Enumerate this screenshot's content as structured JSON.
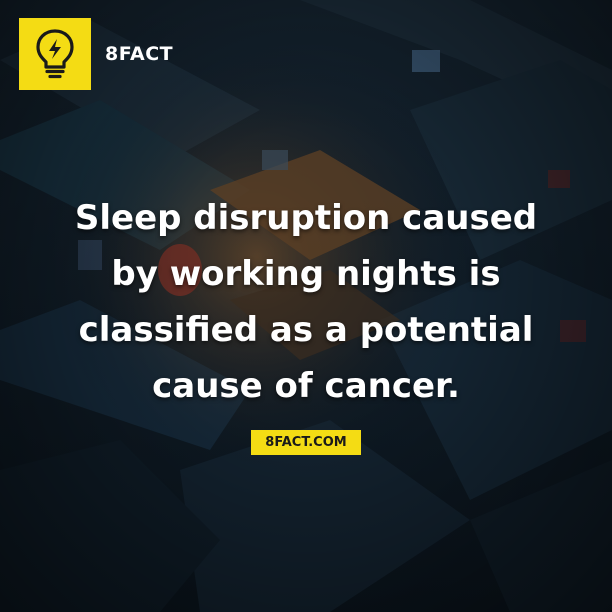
{
  "brand": {
    "name": "8FACT",
    "icon": "lightbulb-icon",
    "accent_color": "#f4dc14"
  },
  "fact": {
    "lines": [
      "Sleep disruption caused",
      "by working nights is",
      "classified as a potential",
      "cause of cancer."
    ]
  },
  "site_badge": {
    "label": "8FACT.COM"
  }
}
